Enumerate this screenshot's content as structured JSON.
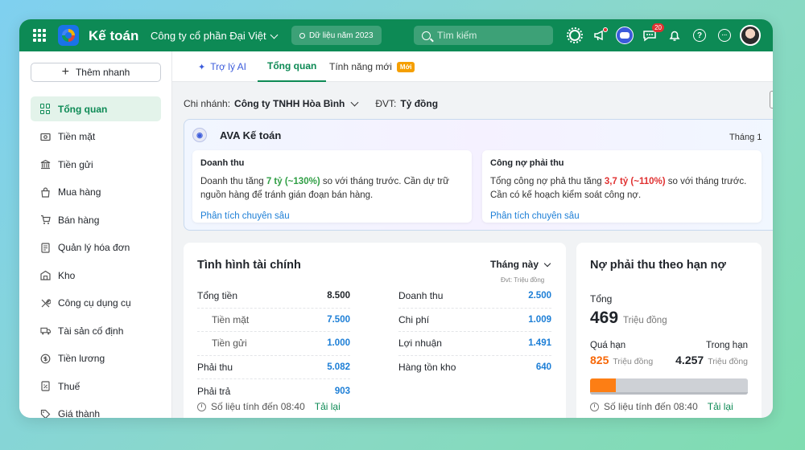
{
  "topbar": {
    "app_title": "Kế toán",
    "company": "Công ty cổ phần Đại Việt",
    "data_year": "Dữ liệu năm 2023",
    "search_placeholder": "Tìm kiếm",
    "chat_badge": "20",
    "help_glyph": "?",
    "more_glyph": "···",
    "icons": [
      "apps-grid-icon",
      "app-logo-icon",
      "settings-icon",
      "announcement-icon",
      "bot-icon",
      "chat-icon",
      "notification-icon",
      "help-icon",
      "more-icon",
      "user-avatar"
    ]
  },
  "sidebar": {
    "quick_add": "Thêm nhanh",
    "items": [
      {
        "label": "Tổng quan",
        "icon": "dashboard-icon",
        "active": true
      },
      {
        "label": "Tiền mặt",
        "icon": "cash-icon"
      },
      {
        "label": "Tiền gửi",
        "icon": "bank-icon"
      },
      {
        "label": "Mua hàng",
        "icon": "shopping-bag-icon"
      },
      {
        "label": "Bán hàng",
        "icon": "cart-icon"
      },
      {
        "label": "Quản lý hóa đơn",
        "icon": "invoice-icon"
      },
      {
        "label": "Kho",
        "icon": "warehouse-icon"
      },
      {
        "label": "Công cụ dụng cụ",
        "icon": "tools-icon"
      },
      {
        "label": "Tài sản cố định",
        "icon": "truck-icon"
      },
      {
        "label": "Tiền lương",
        "icon": "salary-icon"
      },
      {
        "label": "Thuế",
        "icon": "tax-icon"
      },
      {
        "label": "Giá thành",
        "icon": "price-tag-icon"
      }
    ]
  },
  "tabs": {
    "ai": "Trợ lý AI",
    "overview": "Tổng quan",
    "new_features": "Tính năng mới",
    "new_badge": "Mới"
  },
  "filter": {
    "branch_label": "Chi nhánh:",
    "branch_value": "Công ty TNHH Hòa Bình",
    "unit_label": "ĐVT:",
    "unit_value": "Tỷ đồng"
  },
  "ava": {
    "title": "AVA Kế toán",
    "month": "Tháng 1",
    "revenue": {
      "title": "Doanh thu",
      "text_before": "Doanh thu tăng ",
      "highlight": "7 tỷ (~130%)",
      "text_after": " so với tháng trước. Cần dự trữ nguồn hàng để tránh gián đoạn bán hàng.",
      "link": "Phân tích chuyên sâu"
    },
    "receivable": {
      "title": "Công nợ phải thu",
      "text_before": "Tổng công nợ phả thu tăng ",
      "highlight": "3,7 tỷ (~110%)",
      "text_after": " so với tháng trước. Cần có kế hoạch kiểm soát công nợ.",
      "link": "Phân tích chuyên sâu"
    }
  },
  "finance": {
    "title": "Tình hình tài chính",
    "period": "Tháng này",
    "unit_note": "Đvt: Triệu đồng",
    "left_rows": [
      {
        "label": "Tổng tiền",
        "value": "8.500"
      },
      {
        "label": "Tiền mặt",
        "value": "7.500"
      },
      {
        "label": "Tiền gửi",
        "value": "1.000"
      },
      {
        "label": "Phải thu",
        "value": "5.082"
      },
      {
        "label": "Phải trả",
        "value": "903"
      }
    ],
    "right_rows": [
      {
        "label": "Doanh thu",
        "value": "2.500"
      },
      {
        "label": "Chi phí",
        "value": "1.009"
      },
      {
        "label": "Lợi nhuận",
        "value": "1.491"
      },
      {
        "label": "Hàng tồn kho",
        "value": "640"
      }
    ],
    "updated": "Số liệu tính đến 08:40",
    "reload": "Tải lại"
  },
  "receivable_due": {
    "title": "Nợ phải thu theo hạn nợ",
    "total_label": "Tổng",
    "total_value": "469",
    "total_unit": "Triệu đồng",
    "overdue_label": "Quá hạn",
    "overdue_value": "825",
    "overdue_unit": "Triệu đồng",
    "in_term_label": "Trong hạn",
    "in_term_value": "4.257",
    "in_term_unit": "Triệu đồng",
    "overdue_fraction": 0.162,
    "updated": "Số liệu tính đến 08:40",
    "reload": "Tải lại",
    "colors": {
      "overdue": "#fd7e14",
      "in_term": "#ced1d6"
    }
  }
}
